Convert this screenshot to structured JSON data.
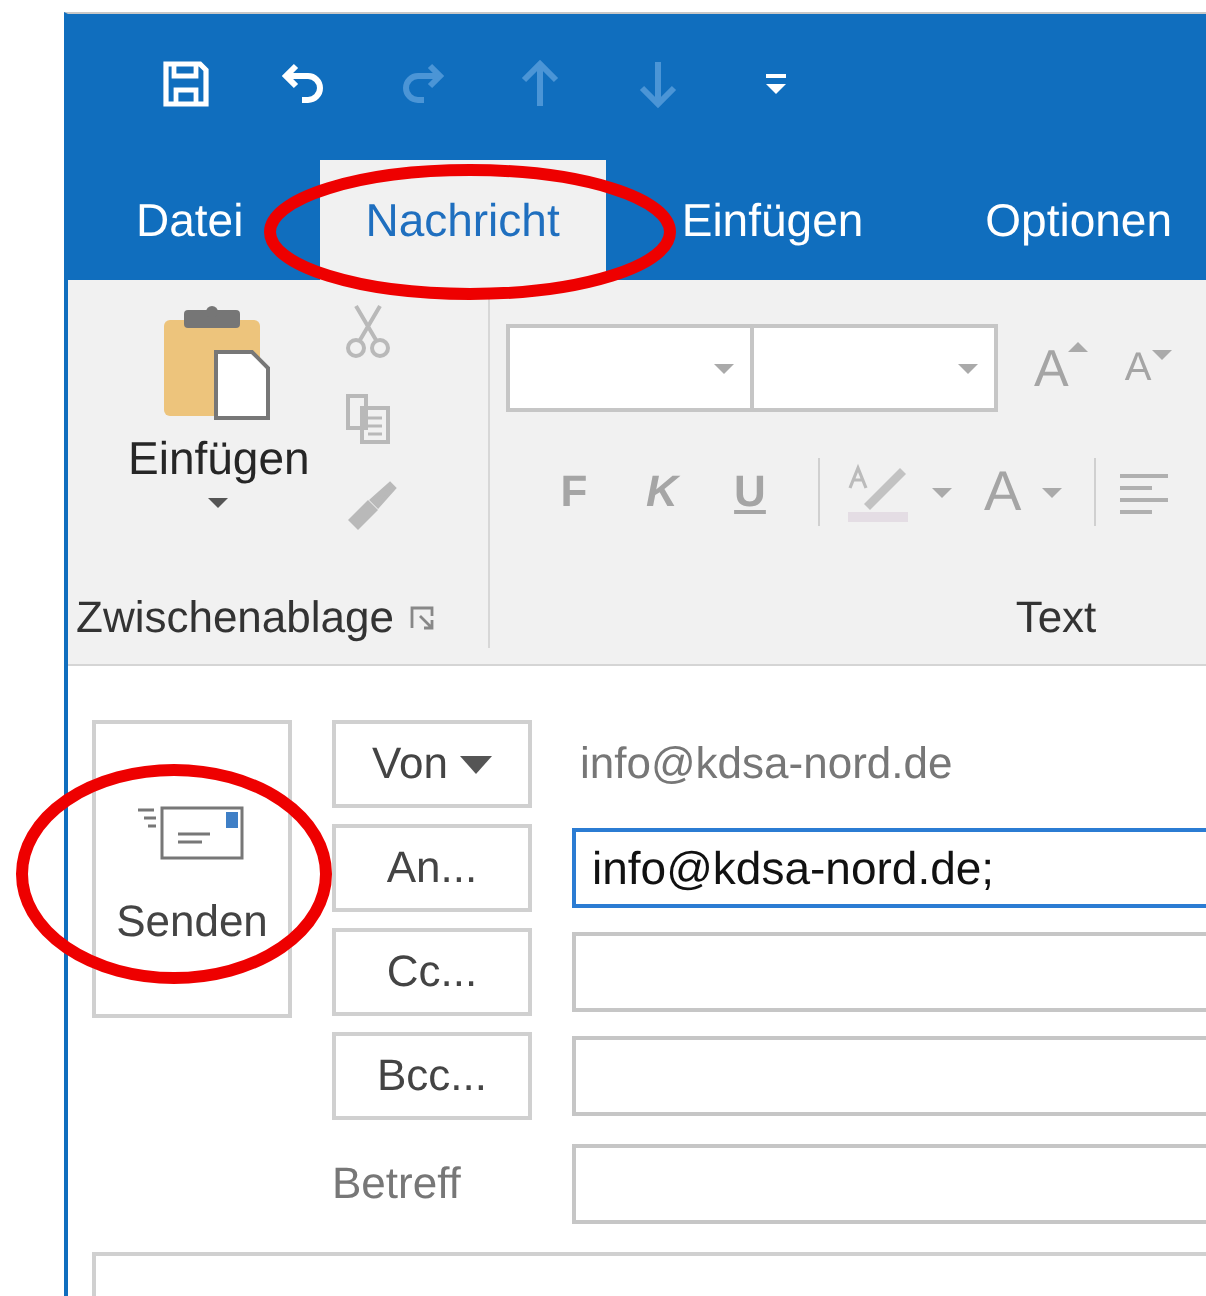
{
  "quick_access": [
    {
      "kind": "save",
      "disabled": false
    },
    {
      "kind": "undo",
      "disabled": false
    },
    {
      "kind": "redo",
      "disabled": true
    },
    {
      "kind": "up",
      "disabled": true
    },
    {
      "kind": "down",
      "disabled": true
    },
    {
      "kind": "customize",
      "disabled": false
    }
  ],
  "tabs": [
    {
      "label": "Datei",
      "selected": false,
      "circled": false
    },
    {
      "label": "Nachricht",
      "selected": true,
      "circled": true
    },
    {
      "label": "Einfügen",
      "selected": false,
      "circled": false
    },
    {
      "label": "Optionen",
      "selected": false,
      "circled": false
    }
  ],
  "ribbon": {
    "clipboard": {
      "paste_label": "Einfügen",
      "tools": [
        {
          "kind": "cut",
          "disabled": true
        },
        {
          "kind": "copy",
          "disabled": true
        },
        {
          "kind": "format-painter",
          "disabled": true
        }
      ],
      "label": "Zwischenablage"
    },
    "text": {
      "grow": "A",
      "shrink": "A",
      "bold": "F",
      "italic": "K",
      "underline": "U",
      "font_color": "A",
      "disabled": true,
      "label": "Text"
    }
  },
  "compose": {
    "send": {
      "label": "Senden",
      "circled": true
    },
    "from": {
      "button": "Von",
      "value": "info@kdsa-nord.de"
    },
    "fields": [
      {
        "button": "An...",
        "value": "info@kdsa-nord.de;",
        "focused": true
      },
      {
        "button": "Cc...",
        "focused": false
      },
      {
        "button": "Bcc...",
        "focused": false
      }
    ],
    "subject": {
      "label": "Betreff"
    }
  }
}
